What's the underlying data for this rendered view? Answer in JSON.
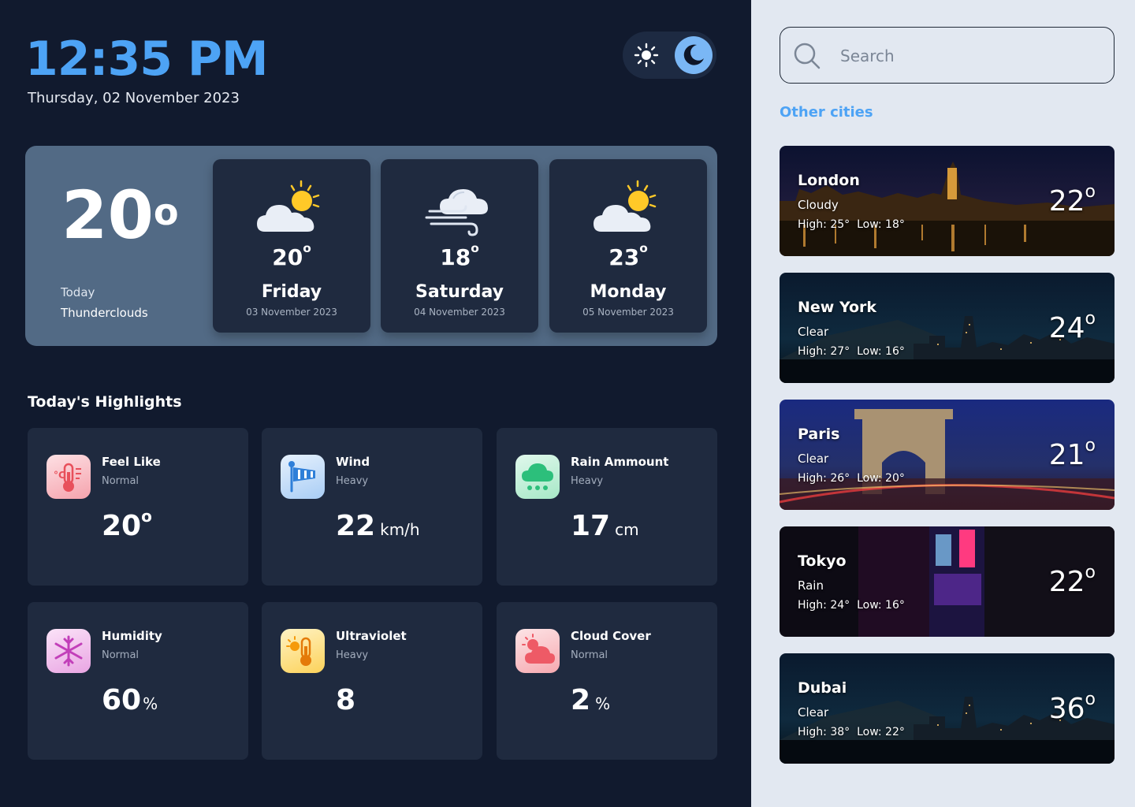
{
  "header": {
    "time": "12:35 PM",
    "date": "Thursday, 02 November 2023"
  },
  "theme_toggle": {
    "options": [
      "sun-icon",
      "moon-icon"
    ],
    "active": "moon-icon",
    "active_color": "#7ab7f5"
  },
  "today": {
    "temp": "20",
    "label": "Today",
    "condition": "Thunderclouds"
  },
  "forecast": [
    {
      "temp": "20",
      "day": "Friday",
      "date": "03 November 2023",
      "icon": "partly-sunny-icon"
    },
    {
      "temp": "18",
      "day": "Saturday",
      "date": "04 November 2023",
      "icon": "windy-cloud-icon"
    },
    {
      "temp": "23",
      "day": "Monday",
      "date": "05 November 2023",
      "icon": "partly-sunny-icon"
    }
  ],
  "highlights": {
    "title": "Today's Highlights",
    "items": [
      {
        "label": "Feel Like",
        "sub": "Normal",
        "value": "20",
        "unit": "",
        "degree": true,
        "icon": "thermometer-icon",
        "icon_bg": "#f9c9cf"
      },
      {
        "label": "Wind",
        "sub": "Heavy",
        "value": "22",
        "unit": "km/h",
        "degree": false,
        "icon": "windsock-icon",
        "icon_bg": "#cfe3fb"
      },
      {
        "label": "Rain Ammount",
        "sub": "Heavy",
        "value": "17",
        "unit": "cm",
        "degree": false,
        "icon": "rain-cloud-icon",
        "icon_bg": "#c9f1dc"
      },
      {
        "label": "Humidity",
        "sub": "Normal",
        "value": "60",
        "unit": "%",
        "degree": false,
        "icon": "snowflake-icon",
        "icon_bg": "#f5cdf0"
      },
      {
        "label": "Ultraviolet",
        "sub": "Heavy",
        "value": "8",
        "unit": "",
        "degree": false,
        "icon": "sun-thermometer-icon",
        "icon_bg": "#fde9a8"
      },
      {
        "label": "Cloud Cover",
        "sub": "Normal",
        "value": "2",
        "unit": "%",
        "degree": false,
        "icon": "sun-cloud-icon",
        "icon_bg": "#fbd2d6"
      }
    ]
  },
  "sidebar": {
    "search_placeholder": "Search",
    "other_cities": "Other cities",
    "cities": [
      {
        "name": "London",
        "condition": "Cloudy",
        "high": "High: 25°",
        "low": "Low: 18°",
        "temp": "22"
      },
      {
        "name": "New York",
        "condition": "Clear",
        "high": "High: 27°",
        "low": "Low: 16°",
        "temp": "24"
      },
      {
        "name": "Paris",
        "condition": "Clear",
        "high": "High: 26°",
        "low": "Low: 20°",
        "temp": "21"
      },
      {
        "name": "Tokyo",
        "condition": "Rain",
        "high": "High: 24°",
        "low": "Low: 16°",
        "temp": "22"
      },
      {
        "name": "Dubai",
        "condition": "Clear",
        "high": "High: 38°",
        "low": "Low: 22°",
        "temp": "36"
      }
    ]
  }
}
